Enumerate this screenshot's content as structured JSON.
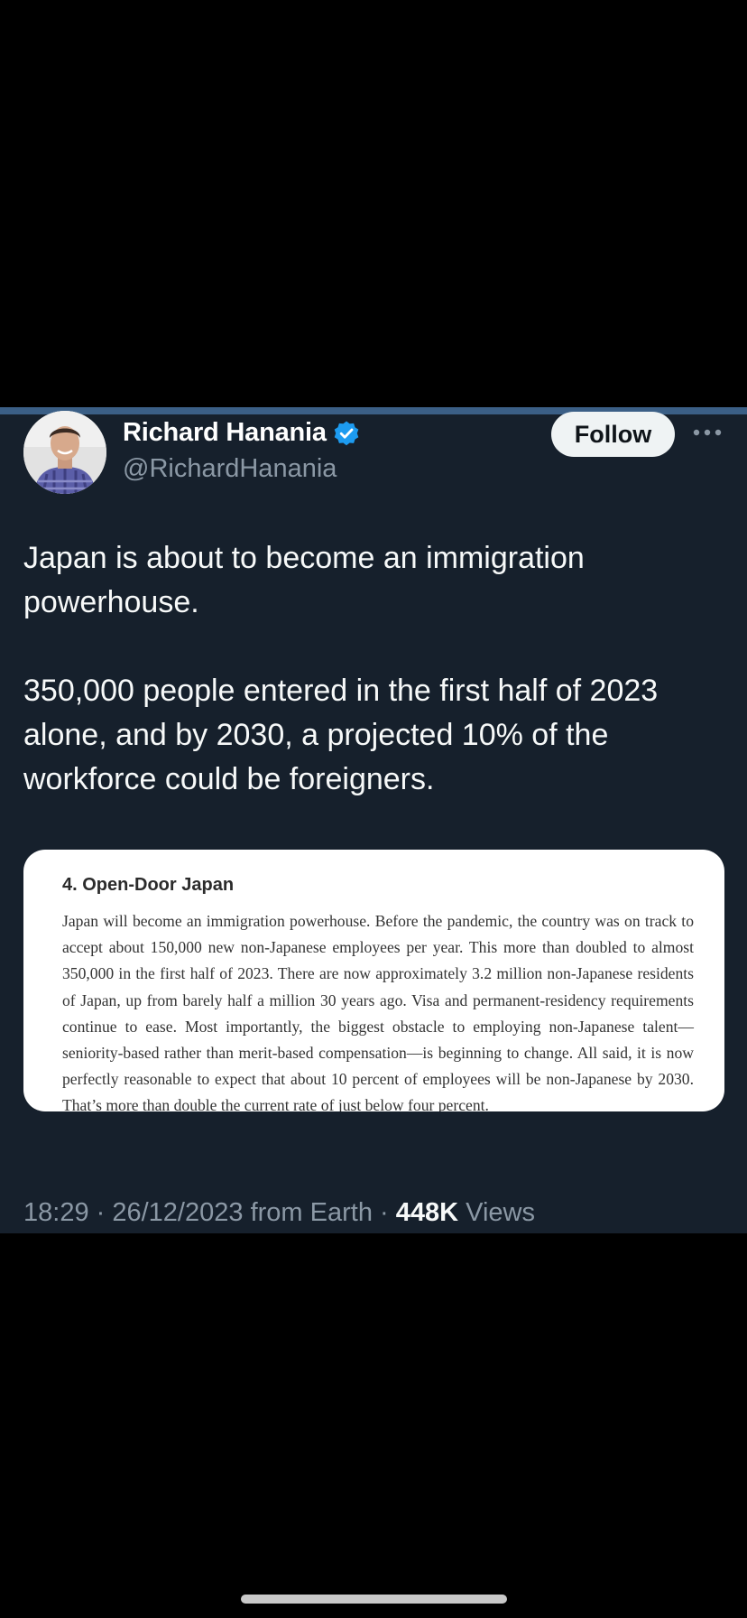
{
  "author": {
    "display_name": "Richard Hanania",
    "handle": "@RichardHanania",
    "verified": true,
    "verified_color": "#1d9bf0"
  },
  "follow_label": "Follow",
  "more_icon": "ellipsis-icon",
  "tweet": {
    "paragraphs": [
      "Japan is about to become an immigration powerhouse.",
      "350,000 people entered in the first half of 2023 alone, and by 2030, a projected 10% of the workforce could be foreigners."
    ]
  },
  "media": {
    "heading": "4. Open-Door Japan",
    "body": "Japan will become an immigration powerhouse. Before the pandemic, the country was on track to accept about 150,000 new non-Japanese employees per year. This more than doubled to almost 350,000 in the first half of 2023. There are now approximately 3.2 million non-Japanese residents of Japan, up from barely half a million 30 years ago. Visa and permanent-residency requirements continue to ease. Most importantly, the biggest obstacle to employing non-Japanese talent—seniority-based rather than merit-based compensation—is beginning to change. All said, it is now perfectly reasonable to expect that about 10 percent of employees will be non-Japanese by 2030. That’s more than double the current rate of just below four percent."
  },
  "meta": {
    "time": "18:29",
    "separator": " · ",
    "date": "26/12/2023",
    "source": " from Earth",
    "views_count": "448K",
    "views_label": " Views"
  },
  "colors": {
    "background": "#000000",
    "card": "#16202c",
    "accent_line": "#3b5f86",
    "text_primary": "#f7f9f9",
    "text_secondary": "#8b98a5"
  }
}
